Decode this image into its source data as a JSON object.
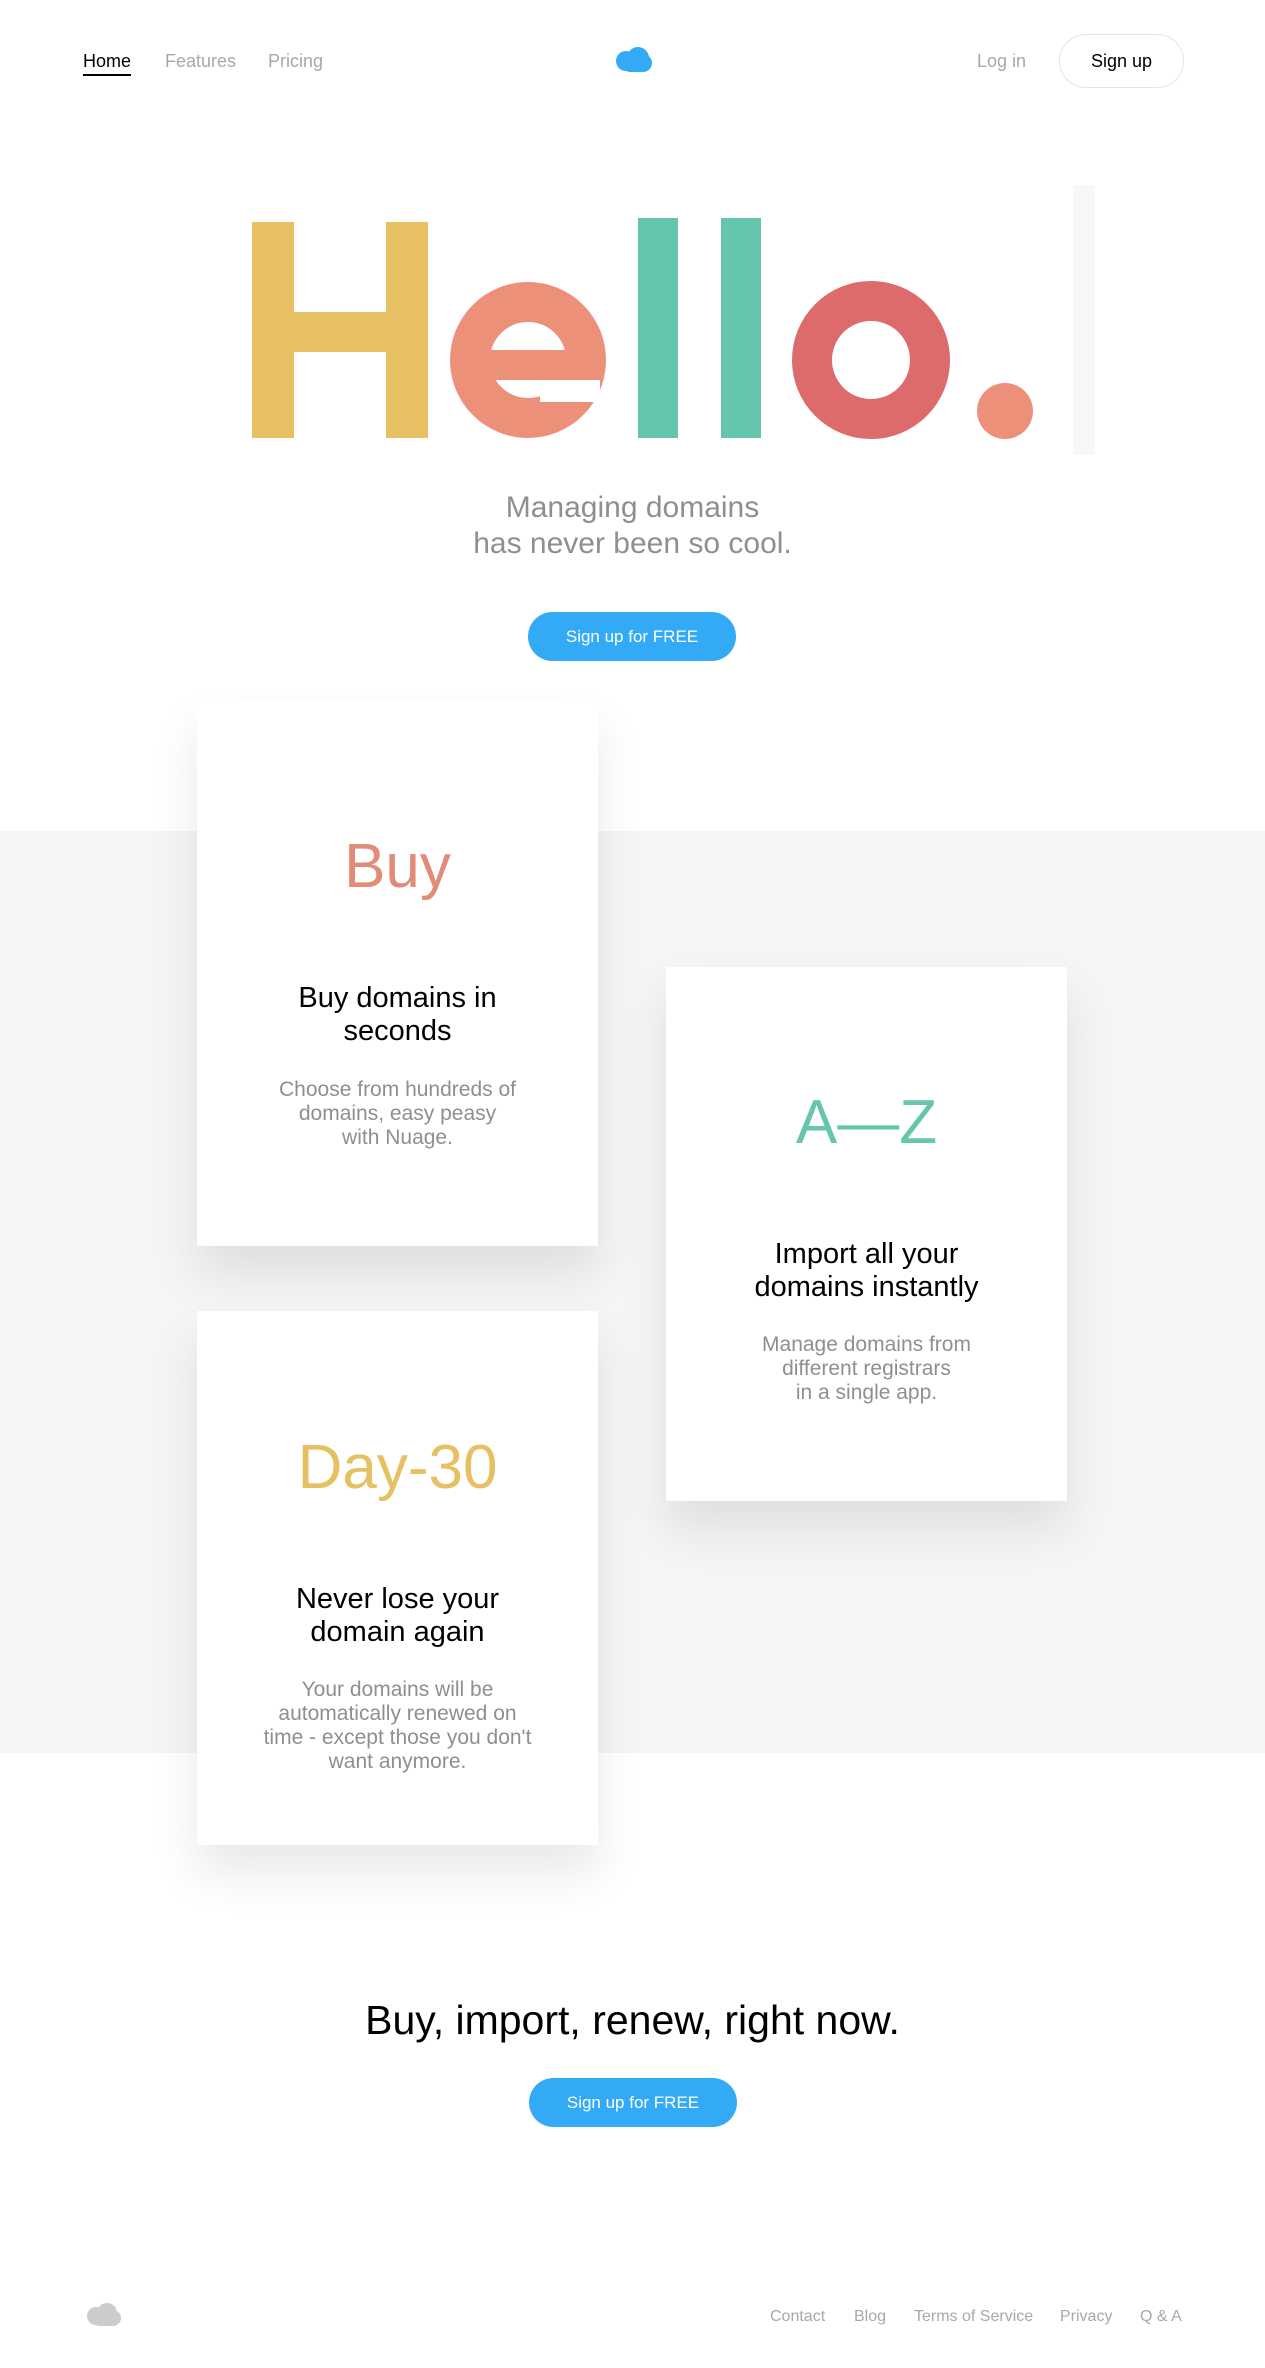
{
  "nav": {
    "links": [
      {
        "label": "Home",
        "active": true
      },
      {
        "label": "Features",
        "active": false
      },
      {
        "label": "Pricing",
        "active": false
      }
    ],
    "logo_icon": "cloud-icon",
    "login_label": "Log in",
    "signup_label": "Sign up"
  },
  "hero": {
    "headline": "Hello.",
    "headline_colors": {
      "H": "#e6c062",
      "e": "#ec907a",
      "l1": "#66c5ad",
      "l2": "#66c5ad",
      "o": "#dd6b6b",
      "dot": "#ec907a"
    },
    "tagline_line1": "Managing domains",
    "tagline_line2": "has never been so cool.",
    "cta_label": "Sign up for FREE"
  },
  "features": [
    {
      "big": "Buy",
      "big_color": "#e08c78",
      "title_line1": "Buy domains in",
      "title_line2": "seconds",
      "text_lines": [
        "Choose from hundreds of",
        "domains, easy peasy",
        "with Nuage."
      ]
    },
    {
      "big": "A—Z",
      "big_color": "#66c5ad",
      "title_line1": "Import all your",
      "title_line2": "domains instantly",
      "text_lines": [
        "Manage domains from",
        "different registrars",
        "in a single app."
      ]
    },
    {
      "big": "Day-30",
      "big_color": "#e6c062",
      "title_line1": "Never lose your",
      "title_line2": "domain again",
      "text_lines": [
        "Your domains will be",
        "automatically renewed on",
        "time - except those you don't",
        "want anymore."
      ]
    }
  ],
  "closing": {
    "title": "Buy, import, renew, right now.",
    "cta_label": "Sign up for FREE"
  },
  "footer": {
    "logo_icon": "cloud-icon",
    "links": [
      "Contact",
      "Blog",
      "Terms of Service",
      "Privacy",
      "Q & A"
    ]
  },
  "colors": {
    "accent": "#33aaf5",
    "band": "#f5f5f5",
    "muted_text": "#8f8f8f"
  }
}
